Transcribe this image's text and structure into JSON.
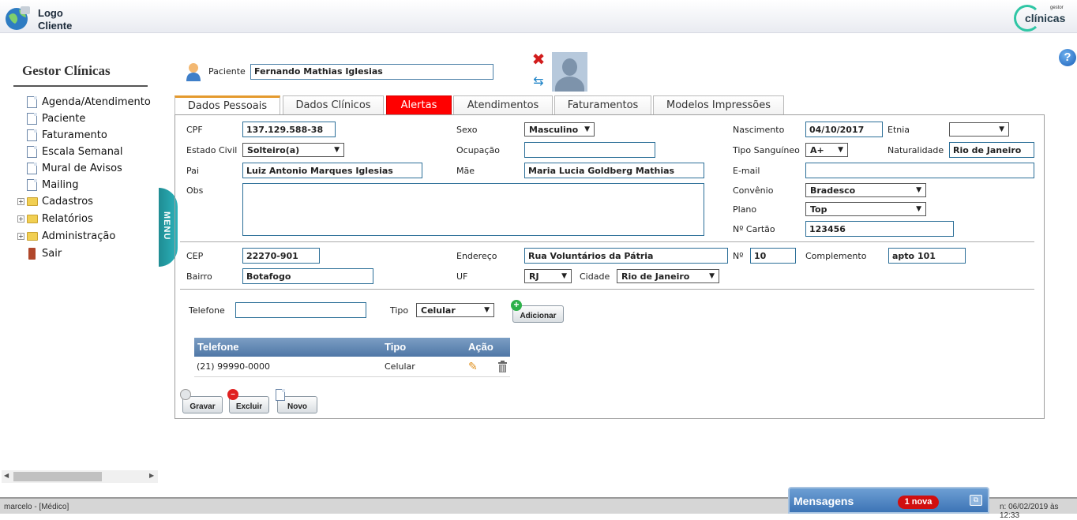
{
  "header": {
    "logo_line1": "Logo",
    "logo_line2": "Cliente",
    "brand_small": "gestor",
    "brand_big": "clínicas"
  },
  "help": {
    "label": "?"
  },
  "sidebar": {
    "title": "Gestor Clínicas",
    "menu_tab": "MENU",
    "items": [
      {
        "label": "Agenda/Atendimento",
        "icon": "document-icon"
      },
      {
        "label": "Paciente",
        "icon": "document-icon"
      },
      {
        "label": "Faturamento",
        "icon": "document-icon"
      },
      {
        "label": "Escala Semanal",
        "icon": "document-icon"
      },
      {
        "label": "Mural de Avisos",
        "icon": "document-icon"
      },
      {
        "label": "Mailing",
        "icon": "document-icon"
      },
      {
        "label": "Cadastros",
        "icon": "folder-icon",
        "expand": "+"
      },
      {
        "label": "Relatórios",
        "icon": "folder-icon",
        "expand": "+"
      },
      {
        "label": "Administração",
        "icon": "folder-icon",
        "expand": "+"
      },
      {
        "label": "Sair",
        "icon": "exit-icon"
      }
    ]
  },
  "patient": {
    "label": "Paciente",
    "value": "Fernando Mathias Iglesias"
  },
  "tabs": [
    "Dados Pessoais",
    "Dados Clínicos",
    "Alertas",
    "Atendimentos",
    "Faturamentos",
    "Modelos Impressões"
  ],
  "form": {
    "cpf": {
      "label": "CPF",
      "value": "137.129.588-38"
    },
    "sexo": {
      "label": "Sexo",
      "value": "Masculino"
    },
    "nascimento": {
      "label": "Nascimento",
      "value": "04/10/2017"
    },
    "etnia": {
      "label": "Etnia",
      "value": ""
    },
    "estado_civil": {
      "label": "Estado Civil",
      "value": "Solteiro(a)"
    },
    "ocupacao": {
      "label": "Ocupação",
      "value": ""
    },
    "tipo_sanguineo": {
      "label": "Tipo Sanguíneo",
      "value": "A+"
    },
    "naturalidade": {
      "label": "Naturalidade",
      "value": "Rio de Janeiro"
    },
    "pai": {
      "label": "Pai",
      "value": "Luiz Antonio Marques Iglesias"
    },
    "mae": {
      "label": "Mãe",
      "value": "Maria Lucia Goldberg Mathias"
    },
    "email": {
      "label": "E-mail",
      "value": ""
    },
    "obs": {
      "label": "Obs",
      "value": ""
    },
    "convenio": {
      "label": "Convênio",
      "value": "Bradesco"
    },
    "plano": {
      "label": "Plano",
      "value": "Top"
    },
    "cartao": {
      "label": "Nº Cartão",
      "value": "123456"
    },
    "cep": {
      "label": "CEP",
      "value": "22270-901"
    },
    "endereco": {
      "label": "Endereço",
      "value": "Rua Voluntários da Pátria"
    },
    "numero": {
      "label": "Nº",
      "value": "10"
    },
    "complemento": {
      "label": "Complemento",
      "value": "apto 101"
    },
    "bairro": {
      "label": "Bairro",
      "value": "Botafogo"
    },
    "uf": {
      "label": "UF",
      "value": "RJ"
    },
    "cidade": {
      "label": "Cidade",
      "value": "Rio de Janeiro"
    },
    "telefone": {
      "label": "Telefone",
      "value": ""
    },
    "tipo": {
      "label": "Tipo",
      "value": "Celular"
    },
    "adicionar": "Adicionar"
  },
  "phones": {
    "headers": [
      "Telefone",
      "Tipo",
      "Ação"
    ],
    "rows": [
      {
        "telefone": "(21) 99990-0000",
        "tipo": "Celular"
      }
    ]
  },
  "actions": {
    "gravar": "Gravar",
    "excluir": "Excluir",
    "novo": "Novo"
  },
  "status": {
    "user": "marcelo - [Médico]",
    "date": "n: 06/02/2019  às 12:33"
  },
  "messages": {
    "title": "Mensagens",
    "badge": "1 nova"
  }
}
